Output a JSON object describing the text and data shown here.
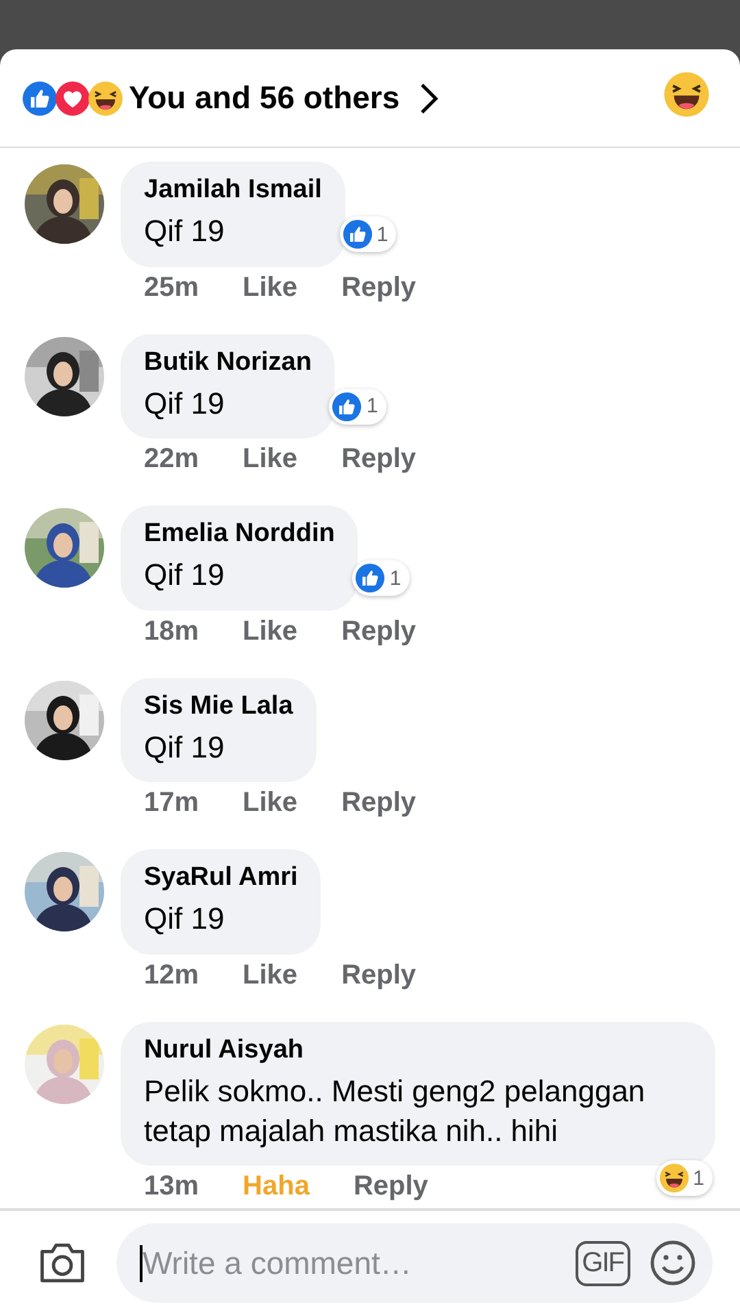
{
  "header": {
    "summary": "You and 56 others",
    "reactions": [
      {
        "kind": "like"
      },
      {
        "kind": "love"
      },
      {
        "kind": "haha"
      }
    ],
    "my_reaction": {
      "kind": "haha"
    }
  },
  "comments": [
    {
      "name": "Jamilah Ismail",
      "text": "Qif 19",
      "time": "25m",
      "action": {
        "label": "Like",
        "selected": false
      },
      "reply": "Reply",
      "badge": {
        "kind": "like",
        "count": "1"
      }
    },
    {
      "name": "Butik Norizan",
      "text": "Qif 19",
      "time": "22m",
      "action": {
        "label": "Like",
        "selected": false
      },
      "reply": "Reply",
      "badge": {
        "kind": "like",
        "count": "1"
      }
    },
    {
      "name": "Emelia Norddin",
      "text": "Qif 19",
      "time": "18m",
      "action": {
        "label": "Like",
        "selected": false
      },
      "reply": "Reply",
      "badge": {
        "kind": "like",
        "count": "1"
      }
    },
    {
      "name": "Sis Mie Lala",
      "text": "Qif 19",
      "time": "17m",
      "action": {
        "label": "Like",
        "selected": false
      },
      "reply": "Reply"
    },
    {
      "name": "SyaRul Amri",
      "text": "Qif 19",
      "time": "12m",
      "action": {
        "label": "Like",
        "selected": false
      },
      "reply": "Reply"
    },
    {
      "name": "Nurul Aisyah",
      "text": "Pelik sokmo.. Mesti geng2 pelanggan tetap majalah mastika nih.. hihi",
      "time": "13m",
      "action": {
        "label": "Haha",
        "selected": true
      },
      "reply": "Reply",
      "badge": {
        "kind": "haha",
        "count": "1"
      }
    }
  ],
  "composer": {
    "placeholder": "Write a comment…",
    "gif": "GIF"
  }
}
